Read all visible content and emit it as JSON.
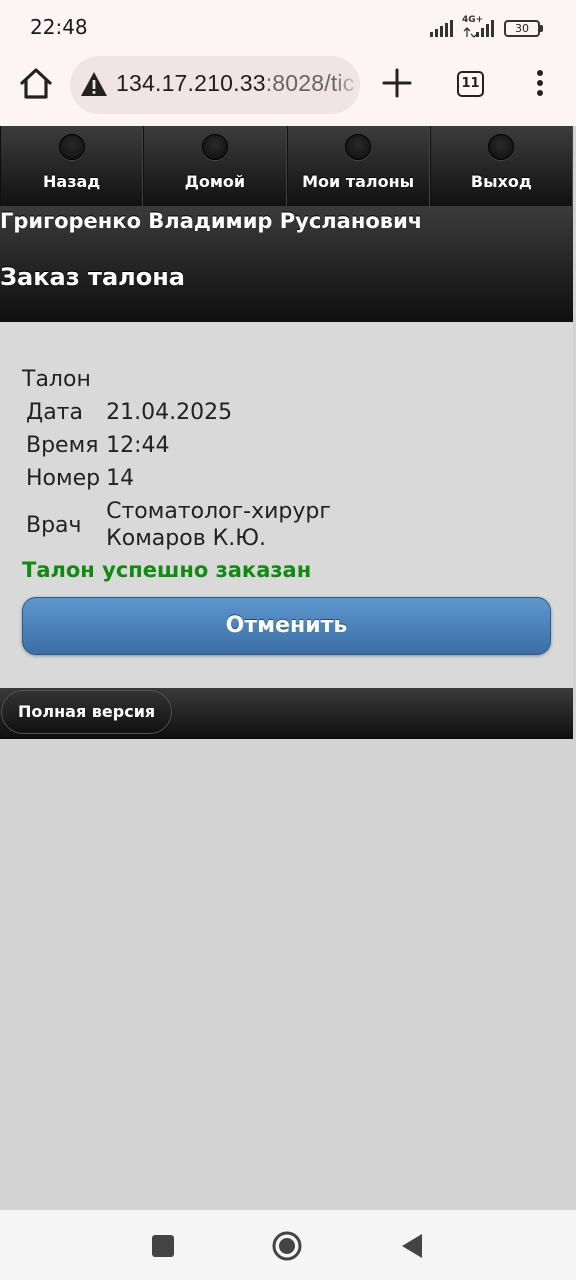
{
  "status_bar": {
    "time": "22:48",
    "network": "4G+",
    "battery": "30"
  },
  "browser": {
    "url_host": "134.17.210.33",
    "url_rest": ":8028/tic",
    "tab_count": "11"
  },
  "nav": {
    "items": [
      {
        "label": "Назад"
      },
      {
        "label": "Домой"
      },
      {
        "label": "Мои талоны"
      },
      {
        "label": "Выход"
      }
    ]
  },
  "header": {
    "patient_name": "Григоренко Владимир Русланович",
    "title": "Заказ талона"
  },
  "ticket": {
    "heading": "Талон",
    "rows": [
      {
        "label": "Дата",
        "value": "21.04.2025"
      },
      {
        "label": "Время",
        "value": "12:44"
      },
      {
        "label": "Номер",
        "value": "14"
      },
      {
        "label": "Врач",
        "value_line1": "Стоматолог-хирург",
        "value_line2": "Комаров К.Ю."
      }
    ],
    "status": "Талон успешно заказан",
    "cancel_label": "Отменить"
  },
  "footer": {
    "full_version_label": "Полная версия"
  },
  "colors": {
    "success": "#118a11",
    "button_blue": "#4a82bb",
    "header_dark": "#1a1a1a"
  }
}
